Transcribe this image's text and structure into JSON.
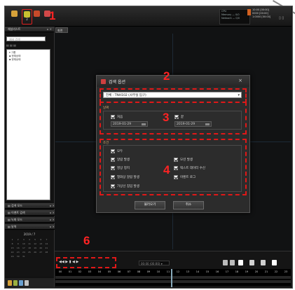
{
  "markers": {
    "m1": "1",
    "m2": "2",
    "m3": "3",
    "m4": "4",
    "m6": "6"
  },
  "toolbar": {
    "buttons": [
      {
        "label": "",
        "color": "#d6a23a"
      },
      {
        "label": "2",
        "color": "#c8c030"
      },
      {
        "label": "",
        "color": "#c84a2a"
      },
      {
        "label": "",
        "color": "#d04848"
      }
    ],
    "status_lines": [
      "CPU",
      "Memory   —   0/0",
      "Network   —   0/0"
    ],
    "user_lines": [
      "10:00 [00:00]",
      "0000 [00:00]",
      "1:0000 [00:00]"
    ],
    "window_controls": "▯  ▯"
  },
  "left_panel": {
    "title": "채널리스트",
    "title_ctrl": "▸ ×",
    "search_placeholder": "채널 검색",
    "filter": "▤ ▤ ▤",
    "tree": [
      "▾ 그룹",
      "  ▪ 현재상태",
      "  ▪ 현재상태"
    ],
    "sections": [
      {
        "title": "▤ 검색 모드",
        "ctrl": "▸ ×"
      },
      {
        "title": "▤ 이벤트 검색",
        "ctrl": "▸ ×"
      },
      {
        "title": "▤ 녹화 모드",
        "ctrl": "▸ ×"
      },
      {
        "title": "▤ 달력",
        "ctrl": "▸ ×"
      }
    ],
    "calendar_month": "2019 / 7",
    "calendar_days": [
      "1",
      "2",
      "3",
      "4",
      "5",
      "6",
      "7",
      "8",
      "9",
      "10",
      "11",
      "12",
      "13",
      "14",
      "15",
      "16",
      "17",
      "18",
      "19",
      "20",
      "21",
      "22",
      "23",
      "24",
      "25",
      "26",
      "27",
      "28",
      "29",
      "30",
      "31"
    ]
  },
  "main": {
    "tab_label": "화면"
  },
  "dialog": {
    "title": "검색 옵션",
    "close": "×",
    "channel_value": "전체 : TNH102 (사무실 입구)",
    "date_group_label": "날짜",
    "start_label": "처음",
    "start_date": "2019-01-29",
    "end_label": "끝",
    "end_date": "2019-01-29",
    "condition_group_label": "조건",
    "conditions_left": [
      "모두",
      "알람 발생",
      "영상 정지",
      "열화상 알람 발생",
      "가상선 침입 발생"
    ],
    "conditions_right": [
      "모션 발생",
      "텍스트 데이터 수신",
      "이벤트 로그"
    ],
    "ok_button": "불러오기",
    "cancel_button": "취소"
  },
  "playback": {
    "left_controls": "◀◀  ▶  ▮        ◀  ▶",
    "time_display": "00:00  (00:00)  ▾",
    "right_tools": [
      {
        "color": "#bbbbbb"
      },
      {
        "color": "#bbbbbb"
      },
      {
        "color": "#ffffff"
      },
      {
        "color": "#d0d0d0"
      },
      {
        "color": "#d0d0d0"
      },
      {
        "color": "#ffffff"
      }
    ],
    "timeline_hours": [
      "00",
      "01",
      "02",
      "03",
      "04",
      "05",
      "06",
      "07",
      "08",
      "09",
      "10",
      "11",
      "12",
      "13",
      "14",
      "15",
      "16",
      "17",
      "18",
      "19",
      "20",
      "21",
      "22",
      "23"
    ]
  }
}
